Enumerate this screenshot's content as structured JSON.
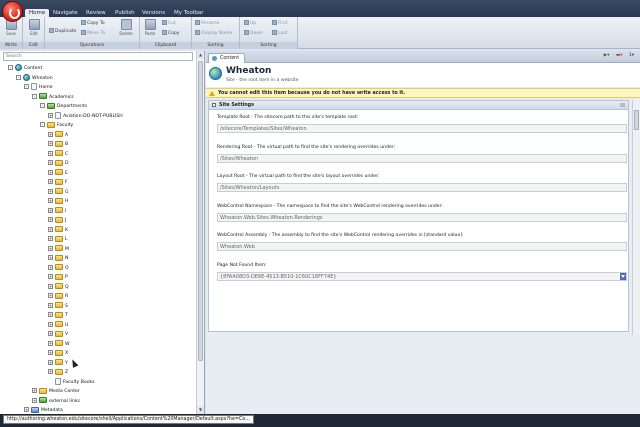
{
  "ribbon": {
    "tabs": [
      "Home",
      "Navigate",
      "Review",
      "Publish",
      "Versions",
      "My Toolbar"
    ],
    "groups": {
      "write": {
        "caption": "Write",
        "save_label": "Save"
      },
      "edit": {
        "caption": "Edit",
        "edit_label": "Edit"
      },
      "operations": {
        "caption": "Operations",
        "duplicate_label": "Duplicate",
        "copy_to_label": "Copy To",
        "move_to_label": "Move To",
        "delete_label": "Delete"
      },
      "clipboard": {
        "caption": "Clipboard",
        "paste_label": "Paste",
        "cut_label": "Cut",
        "copy_label": "Copy"
      },
      "sorting_left": {
        "caption": "Sorting",
        "rename_label": "Rename",
        "display_name_label": "Display Name"
      },
      "sorting_right": {
        "caption": "Sorting",
        "up_label": "Up",
        "down_label": "Down",
        "first_label": "First",
        "last_label": "Last"
      }
    }
  },
  "tree": {
    "search_placeholder": "Search",
    "nodes": [
      {
        "label": "Content",
        "icon": "globe",
        "level": 0,
        "expander": "-"
      },
      {
        "label": "Wheaton",
        "icon": "globe",
        "level": 1,
        "expander": "-"
      },
      {
        "label": "Home",
        "icon": "doc",
        "level": 2,
        "expander": "-"
      },
      {
        "label": "Academics",
        "icon": "green",
        "level": 3,
        "expander": "-"
      },
      {
        "label": "Departments",
        "icon": "green",
        "level": 4,
        "expander": "-"
      },
      {
        "label": "Aviation-DO-NOT-PUBLISH",
        "icon": "doc",
        "level": 5,
        "expander": "+"
      },
      {
        "label": "Faculty",
        "icon": "folder",
        "level": 4,
        "expander": "-"
      },
      {
        "label": "A",
        "icon": "folder",
        "level": 5,
        "expander": "+"
      },
      {
        "label": "B",
        "icon": "folder",
        "level": 5,
        "expander": "+"
      },
      {
        "label": "C",
        "icon": "folder",
        "level": 5,
        "expander": "+"
      },
      {
        "label": "D",
        "icon": "folder",
        "level": 5,
        "expander": "+"
      },
      {
        "label": "E",
        "icon": "folder",
        "level": 5,
        "expander": "+"
      },
      {
        "label": "F",
        "icon": "folder",
        "level": 5,
        "expander": "+"
      },
      {
        "label": "G",
        "icon": "folder",
        "level": 5,
        "expander": "+"
      },
      {
        "label": "H",
        "icon": "folder",
        "level": 5,
        "expander": "+"
      },
      {
        "label": "I",
        "icon": "folder",
        "level": 5,
        "expander": "+"
      },
      {
        "label": "J",
        "icon": "folder",
        "level": 5,
        "expander": "+"
      },
      {
        "label": "K",
        "icon": "folder",
        "level": 5,
        "expander": "+"
      },
      {
        "label": "L",
        "icon": "folder",
        "level": 5,
        "expander": "+"
      },
      {
        "label": "M",
        "icon": "folder",
        "level": 5,
        "expander": "+"
      },
      {
        "label": "N",
        "icon": "folder",
        "level": 5,
        "expander": "+"
      },
      {
        "label": "O",
        "icon": "folder",
        "level": 5,
        "expander": "+"
      },
      {
        "label": "P",
        "icon": "folder",
        "level": 5,
        "expander": "+"
      },
      {
        "label": "Q",
        "icon": "folder",
        "level": 5,
        "expander": "+"
      },
      {
        "label": "R",
        "icon": "folder",
        "level": 5,
        "expander": "+"
      },
      {
        "label": "S",
        "icon": "folder",
        "level": 5,
        "expander": "+"
      },
      {
        "label": "T",
        "icon": "folder",
        "level": 5,
        "expander": "+"
      },
      {
        "label": "U",
        "icon": "folder",
        "level": 5,
        "expander": "+"
      },
      {
        "label": "V",
        "icon": "folder",
        "level": 5,
        "expander": "+"
      },
      {
        "label": "W",
        "icon": "folder",
        "level": 5,
        "expander": "+"
      },
      {
        "label": "X",
        "icon": "folder",
        "level": 5,
        "expander": "+"
      },
      {
        "label": "Y",
        "icon": "folder",
        "level": 5,
        "expander": "+"
      },
      {
        "label": "Z",
        "icon": "folder",
        "level": 5,
        "expander": "+"
      },
      {
        "label": "Faculty Books",
        "icon": "doc",
        "level": 5,
        "expander": ""
      },
      {
        "label": "Media Center",
        "icon": "folder",
        "level": 3,
        "expander": "+"
      },
      {
        "label": "external links",
        "icon": "green",
        "level": 3,
        "expander": "+"
      },
      {
        "label": "Metadata",
        "icon": "blue",
        "level": 2,
        "expander": "+"
      },
      {
        "label": "Navigation",
        "icon": "folder",
        "level": 2,
        "expander": "+"
      }
    ]
  },
  "editor": {
    "tab_label": "Content",
    "item_title": "Wheaton",
    "item_subtitle": "Site - the root item in a website",
    "warning": "You cannot edit this item because you do not have write access to it.",
    "section_title": "Site Settings",
    "fields": [
      {
        "label": "Template Root - The sitecore path to this site's template root:",
        "value": "/sitecore/Templates/Sites/Wheaton",
        "dropdown": false
      },
      {
        "label": "Rendering Root - The virtual path to find the site's rendering overrides under:",
        "value": "/Sites/Wheaton",
        "dropdown": false
      },
      {
        "label": "Layout Root - The virtual path to find the site's layout overrides under:",
        "value": "/Sites/Wheaton/Layouts",
        "dropdown": false
      },
      {
        "label": "WebControl Namespace - The namespace to find the site's WebControl rendering overrides under:",
        "value": "Wheaton.Web.Sites.Wheaton.Renderings",
        "dropdown": false
      },
      {
        "label": "WebControl Assembly - The assembly to find the site's WebControl rendering overrides in [standard value]:",
        "value": "Wheaton.Web",
        "dropdown": false
      },
      {
        "label": "Page Not Found Item:",
        "value": "{8FAA08D3-DE6E-4513-B510-1C60C16FF74E}",
        "dropdown": true
      }
    ]
  },
  "status": {
    "url": "http://authoring.wheaton.edu/sitecore/shell/Applications/Content%20Manager/Default.aspx?he=Co..."
  },
  "colors": {
    "ribbon_dark": "#2a3850",
    "warning_bg": "#fff6bf",
    "status_bar": "#1e2735"
  }
}
